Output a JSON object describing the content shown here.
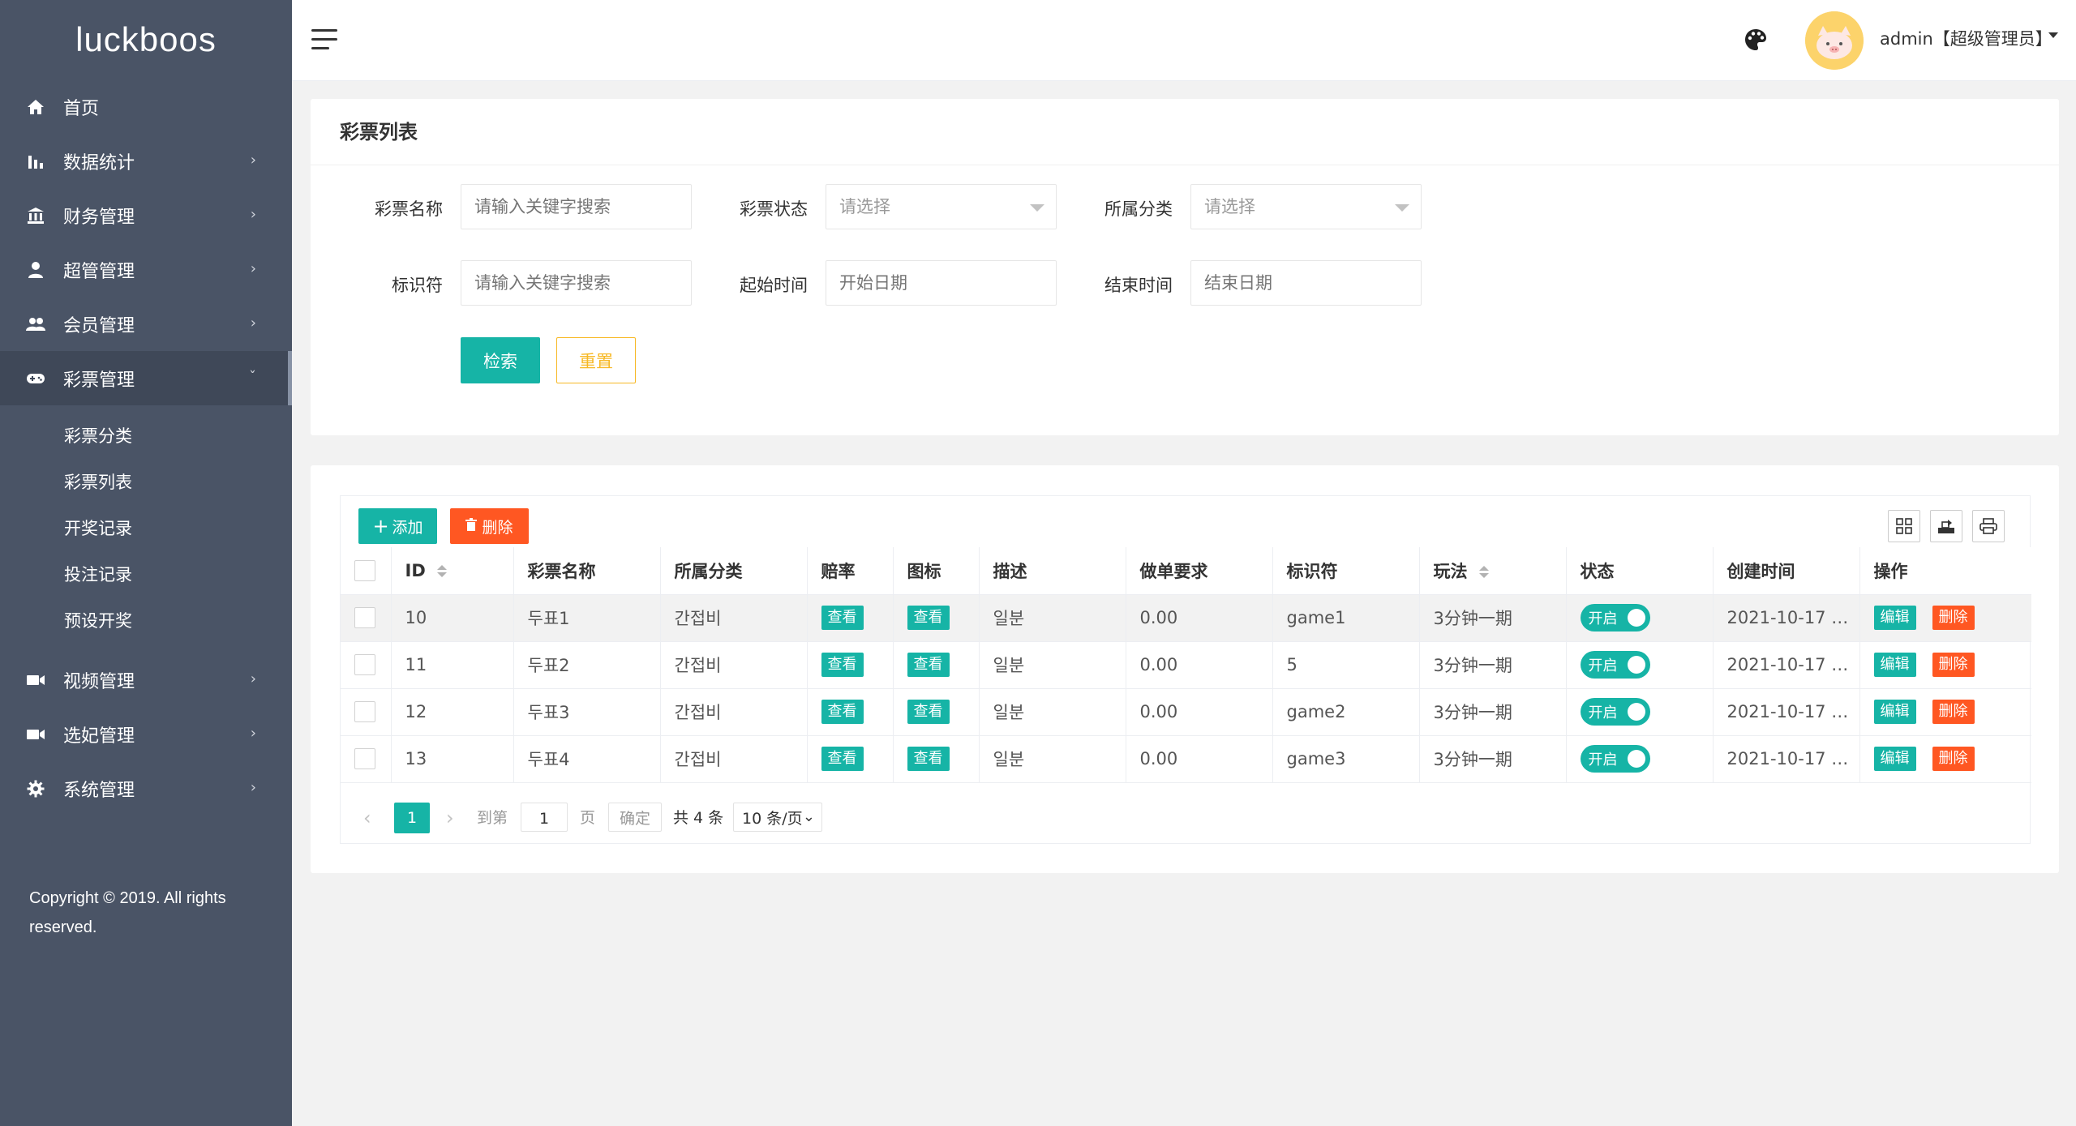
{
  "brand": "luckboos",
  "sidebar": {
    "items": [
      {
        "label": "首页",
        "icon": "home-icon"
      },
      {
        "label": "数据统计",
        "icon": "bar-chart-icon"
      },
      {
        "label": "财务管理",
        "icon": "bank-icon"
      },
      {
        "label": "超管管理",
        "icon": "user-icon"
      },
      {
        "label": "会员管理",
        "icon": "users-icon"
      },
      {
        "label": "彩票管理",
        "icon": "gamepad-icon"
      },
      {
        "label": "视频管理",
        "icon": "video-icon"
      },
      {
        "label": "选妃管理",
        "icon": "camera-icon"
      },
      {
        "label": "系统管理",
        "icon": "gear-icon"
      }
    ],
    "submenu": [
      "彩票分类",
      "彩票列表",
      "开奖记录",
      "投注记录",
      "预设开奖"
    ],
    "copyright": "Copyright © 2019. All rights reserved."
  },
  "header": {
    "user": "admin【超级管理员】"
  },
  "search": {
    "title": "彩票列表",
    "name_label": "彩票名称",
    "name_placeholder": "请输入关键字搜索",
    "status_label": "彩票状态",
    "status_value": "请选择",
    "category_label": "所属分类",
    "category_value": "请选择",
    "key_label": "标识符",
    "key_placeholder": "请输入关键字搜索",
    "start_label": "起始时间",
    "start_placeholder": "开始日期",
    "end_label": "结束时间",
    "end_placeholder": "结束日期",
    "search_button": "检索",
    "reset_button": "重置"
  },
  "toolbar": {
    "add_button": "添加",
    "delete_button": "删除"
  },
  "table": {
    "columns": [
      "ID",
      "彩票名称",
      "所属分类",
      "赔率",
      "图标",
      "描述",
      "做单要求",
      "标识符",
      "玩法",
      "状态",
      "创建时间",
      "操作"
    ],
    "view_label": "查看",
    "switch_label": "开启",
    "edit_label": "编辑",
    "remove_label": "删除",
    "rows": [
      {
        "id": "10",
        "name": "두표1",
        "category": "간접비",
        "desc": "일분",
        "requirement": "0.00",
        "key": "game1",
        "play": "3分钟一期",
        "created": "2021-10-17 …"
      },
      {
        "id": "11",
        "name": "두표2",
        "category": "간접비",
        "desc": "일분",
        "requirement": "0.00",
        "key": "5",
        "play": "3分钟一期",
        "created": "2021-10-17 …"
      },
      {
        "id": "12",
        "name": "두표3",
        "category": "간접비",
        "desc": "일분",
        "requirement": "0.00",
        "key": "game2",
        "play": "3分钟一期",
        "created": "2021-10-17 …"
      },
      {
        "id": "13",
        "name": "두표4",
        "category": "간접비",
        "desc": "일분",
        "requirement": "0.00",
        "key": "game3",
        "play": "3分钟一期",
        "created": "2021-10-17 …"
      }
    ]
  },
  "pager": {
    "current": "1",
    "goto_label": "到第",
    "goto_value": "1",
    "page_label": "页",
    "confirm": "确定",
    "total": "共 4 条",
    "per_page": "10 条/页"
  },
  "colors": {
    "sidebar": "#4a5466",
    "accent": "#16b4a6",
    "danger": "#ff5722",
    "warning": "#f7b824"
  }
}
